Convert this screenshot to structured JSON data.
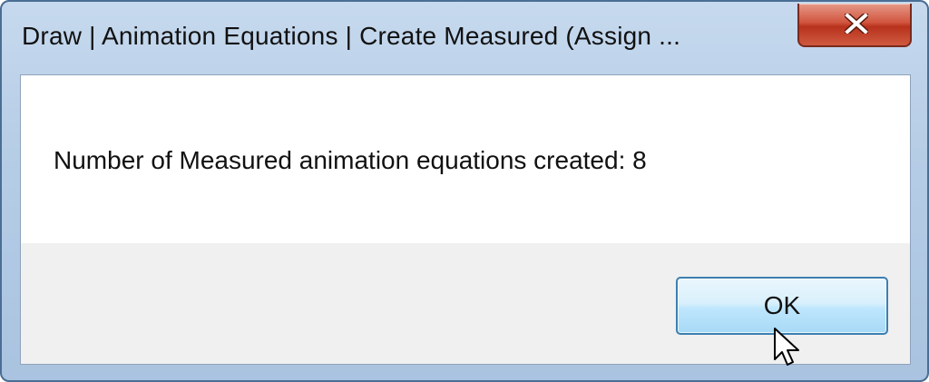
{
  "dialog": {
    "title": "Draw | Animation Equations | Create Measured (Assign ...",
    "message": "Number of Measured animation equations created: 8",
    "ok_label": "OK",
    "close_icon": "close-icon",
    "cursor_icon": "mouse-pointer-icon"
  }
}
